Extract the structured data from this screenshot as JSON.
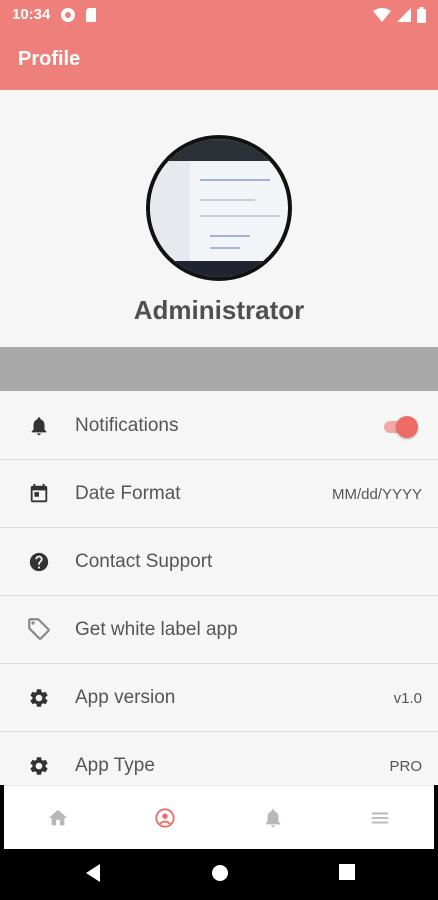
{
  "status_bar": {
    "time": "10:34"
  },
  "app_bar": {
    "title": "Profile"
  },
  "profile": {
    "name": "Administrator"
  },
  "settings": {
    "notifications": {
      "label": "Notifications",
      "enabled": true
    },
    "date_format": {
      "label": "Date Format",
      "value": "MM/dd/YYYY"
    },
    "contact_support": {
      "label": "Contact Support"
    },
    "white_label": {
      "label": "Get white label app"
    },
    "app_version": {
      "label": "App version",
      "value": "v1.0"
    },
    "app_type": {
      "label": "App Type",
      "value": "PRO"
    }
  },
  "colors": {
    "accent": "#ef7f7a",
    "active_tab": "#ef6b65",
    "divider": "#a9a9a9"
  },
  "bottom_nav": [
    "home-icon",
    "profile-icon",
    "bell-icon",
    "menu-icon"
  ],
  "active_tab": "profile-icon"
}
